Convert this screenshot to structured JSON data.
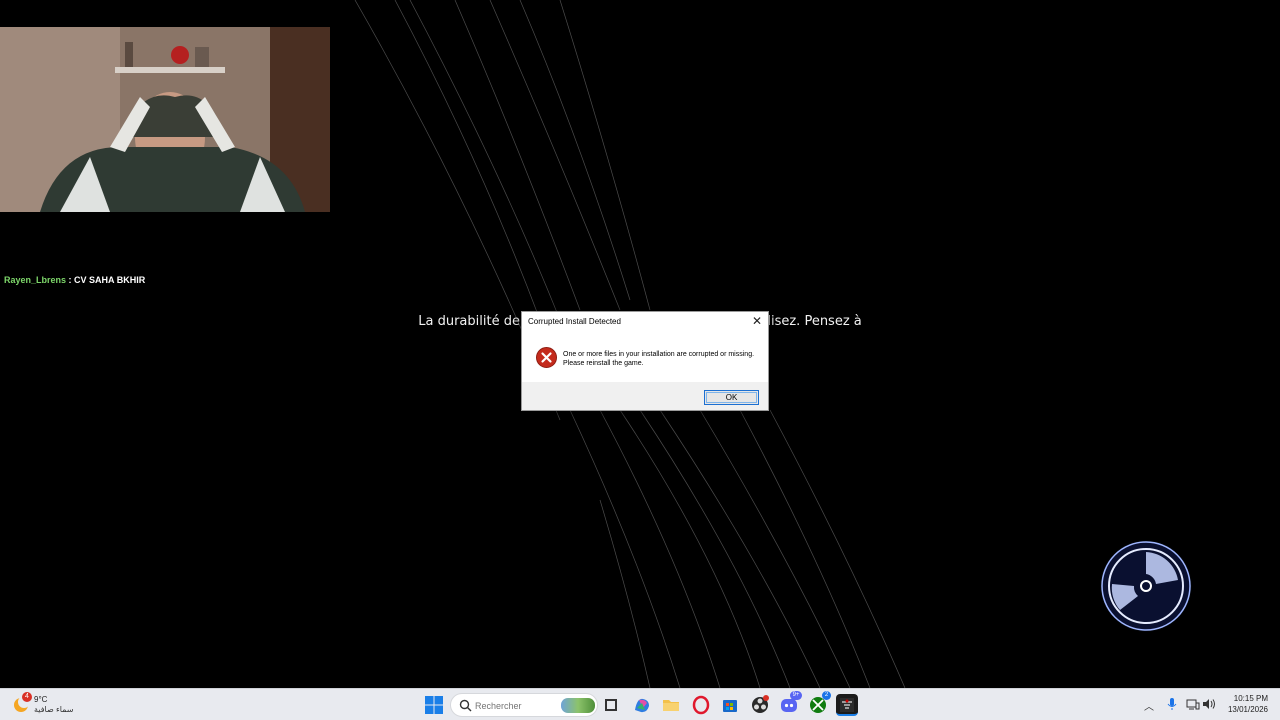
{
  "chat": {
    "username": "Rayen_Lbrens",
    "separator": " : ",
    "message": "CV SAHA BKHIR"
  },
  "game": {
    "message_visible": "La durabilité de                                                           ilisez. Pensez à"
  },
  "dialog": {
    "title": "Corrupted Install Detected",
    "close_glyph": "✕",
    "message": "One or more files in your installation are corrupted or missing. Please reinstall the game.",
    "ok_label": "OK",
    "icon": "error-icon"
  },
  "taskbar": {
    "weather_badge": "4",
    "weather_temp": "9°C",
    "weather_condition": "سماء صافية",
    "search_placeholder": "Rechercher",
    "apps": [
      {
        "name": "file-explorer-taskview",
        "icon": "task-view-icon"
      },
      {
        "name": "copilot",
        "icon": "copilot-icon"
      },
      {
        "name": "file-explorer",
        "icon": "folder-icon"
      },
      {
        "name": "opera",
        "icon": "opera-icon"
      },
      {
        "name": "microsoft-store",
        "icon": "store-icon"
      },
      {
        "name": "obs",
        "icon": "obs-icon"
      },
      {
        "name": "discord",
        "icon": "discord-icon",
        "badge": "9+"
      },
      {
        "name": "xbox",
        "icon": "xbox-icon",
        "badge": "2"
      },
      {
        "name": "game",
        "icon": "game-icon"
      }
    ],
    "clock_time": "10:15 PM",
    "clock_date": "13/01/2026"
  },
  "colors": {
    "username": "#7dd66a",
    "error_red": "#c42b1c",
    "accent": "#1c6fd1",
    "disc_glow": "#3a6fe0"
  }
}
